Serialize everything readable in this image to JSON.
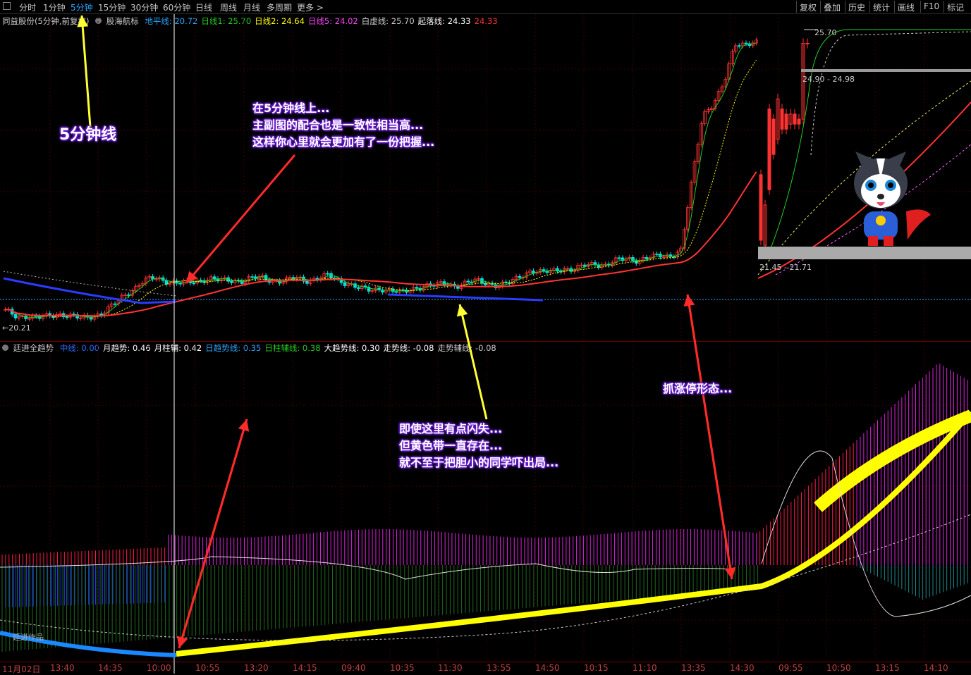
{
  "toolbar": {
    "menu_icon": "menu-icon",
    "periods": [
      "分时",
      "1分钟",
      "5分钟",
      "15分钟",
      "30分钟",
      "60分钟",
      "日线",
      "周线",
      "月线",
      "多周期",
      "更多 >"
    ],
    "active_index": 2,
    "right_items": [
      "复权",
      "叠加",
      "历史",
      "统计",
      "画线",
      "F10",
      "标记"
    ]
  },
  "main_legend": {
    "stock": "同益股份(5分钟,前复权)",
    "indicator": "股海航标",
    "items": [
      {
        "label": "地平线:",
        "value": "20.72",
        "color": "#2aa7ff"
      },
      {
        "label": "日线1:",
        "value": "25.70",
        "color": "#22cc22"
      },
      {
        "label": "日线2:",
        "value": "24.64",
        "color": "#ffff00"
      },
      {
        "label": "日线5:",
        "value": "24.02",
        "color": "#ff44ff"
      },
      {
        "label": "白虚线:",
        "value": "25.70",
        "color": "#cccccc"
      },
      {
        "label": "起落线:",
        "value": "24.33",
        "color": "#ffffff"
      },
      {
        "label": "",
        "value": "24.33",
        "color": "#ff3333"
      }
    ]
  },
  "sub_legend": {
    "indicator": "廷进全趋势",
    "items": [
      {
        "label": "中线:",
        "value": "0.00",
        "color": "#2a6cff"
      },
      {
        "label": "月趋势:",
        "value": "0.46",
        "color": "#ffffff"
      },
      {
        "label": "月柱辅:",
        "value": "0.42",
        "color": "#ffffff"
      },
      {
        "label": "日趋势线:",
        "value": "0.35",
        "color": "#2aa7ff"
      },
      {
        "label": "日柱辅线:",
        "value": "0.38",
        "color": "#22cc22"
      },
      {
        "label": "大趋势线:",
        "value": "0.30",
        "color": "#ffffff"
      },
      {
        "label": "走势线:",
        "value": "-0.08",
        "color": "#ffffff"
      },
      {
        "label": "走势辅线:",
        "value": "-0.08",
        "color": "#cccccc"
      }
    ]
  },
  "price_labels": {
    "high_box_top": "25.70",
    "range_label": "24.90 - 24.98",
    "low_range": "21.45 - 21.71",
    "left_low": "20.21"
  },
  "watermark": "廷进作品",
  "annotations": {
    "label_5min": "5分钟线",
    "note1": [
      "在5分钟线上...",
      "主副图的配合也是一致性相当高...",
      "这样你心里就会更加有了一份把握..."
    ],
    "note2": [
      "即使这里有点闪失...",
      "但黄色带一直存在...",
      "就不至于把胆小的同学吓出局..."
    ],
    "note3": "抓涨停形态..."
  },
  "time_axis": [
    "11月02日",
    "13:40",
    "14:35",
    "10:00",
    "10:55",
    "13:20",
    "14:15",
    "09:40",
    "10:35",
    "11:30",
    "13:55",
    "14:50",
    "10:15",
    "11:10",
    "13:35",
    "14:30",
    "09:55",
    "10:50",
    "13:15",
    "14:10"
  ],
  "colors": {
    "up": "#ff3232",
    "down": "#00e0e0",
    "axis_text": "#c04040"
  },
  "chart_data": [
    {
      "type": "candlestick",
      "title": "同益股份(5分钟,前复权)",
      "series": [
        {
          "name": "地平线",
          "values": [
            20.72
          ]
        },
        {
          "name": "日线1",
          "values": [
            25.7
          ]
        },
        {
          "name": "日线2",
          "values": [
            24.64
          ]
        },
        {
          "name": "日线5",
          "values": [
            24.02
          ]
        },
        {
          "name": "白虚线",
          "values": [
            25.7
          ]
        },
        {
          "name": "起落线",
          "values": [
            24.33
          ]
        }
      ],
      "close_profile": [
        20.4,
        20.3,
        20.3,
        20.25,
        20.3,
        20.35,
        20.3,
        20.25,
        20.3,
        20.35,
        20.5,
        20.7,
        20.85,
        21.0,
        21.05,
        21.0,
        20.95,
        20.95,
        21.0,
        21.05,
        21.0,
        21.0,
        21.0,
        21.05,
        21.05,
        21.0,
        21.0,
        21.05,
        21.0,
        21.05,
        21.1,
        21.0,
        20.95,
        20.85,
        20.8,
        20.85,
        20.8,
        20.75,
        20.85,
        20.9,
        20.9,
        20.95,
        20.9,
        20.95,
        21.0,
        20.95,
        20.9,
        20.95,
        21.1,
        21.2,
        21.15,
        21.2,
        21.25,
        21.2,
        21.3,
        21.35,
        21.3,
        21.4,
        21.45,
        21.4,
        21.45,
        21.5,
        21.5,
        21.6,
        23.0,
        24.3,
        24.5,
        24.9,
        25.7,
        25.7,
        25.7
      ],
      "labels": [
        "25.70",
        "24.90 - 24.98",
        "21.45 - 21.71",
        "20.21"
      ]
    },
    {
      "type": "bar",
      "title": "廷进全趋势",
      "series": [
        {
          "name": "月趋势",
          "values": [
            0.46
          ]
        },
        {
          "name": "月柱辅",
          "values": [
            0.42
          ]
        },
        {
          "name": "日趋势线",
          "values": [
            0.35
          ]
        },
        {
          "name": "日柱辅线",
          "values": [
            0.38
          ]
        },
        {
          "name": "大趋势线",
          "values": [
            0.3
          ]
        },
        {
          "name": "走势线",
          "values": [
            -0.08
          ]
        },
        {
          "name": "走势辅线",
          "values": [
            -0.08
          ]
        }
      ]
    }
  ]
}
